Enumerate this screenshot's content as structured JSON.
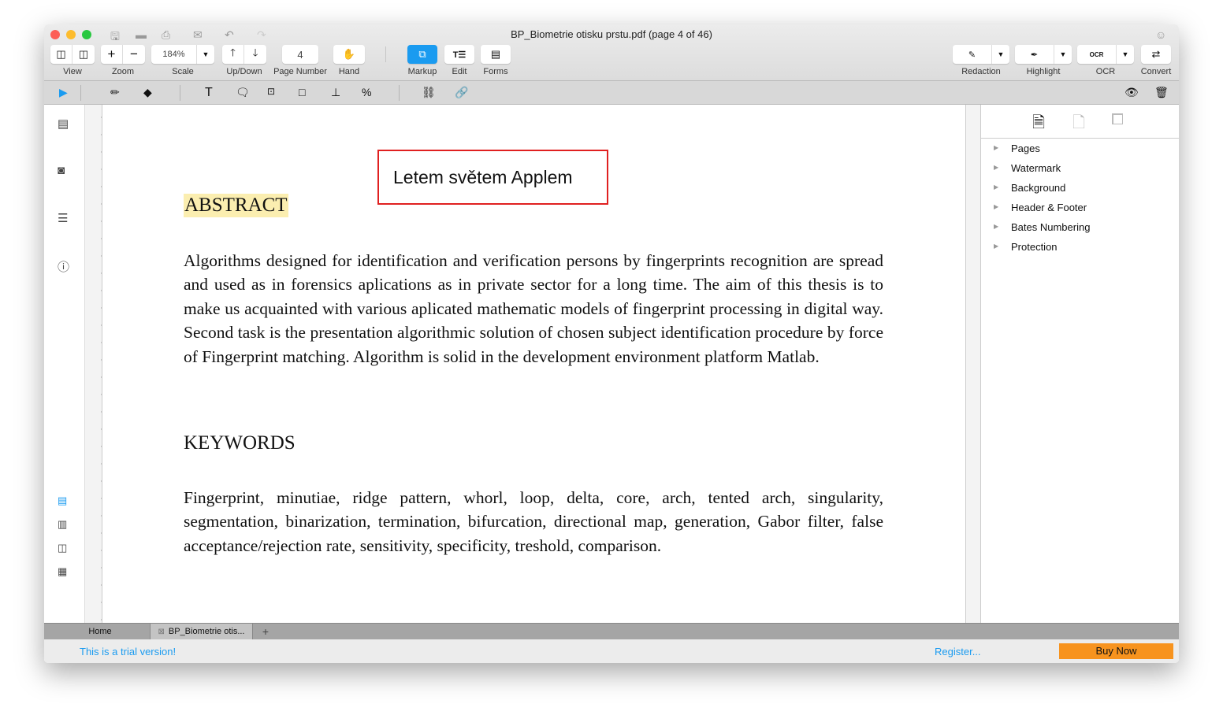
{
  "window": {
    "title": "BP_Biometrie otisku prstu.pdf (page 4 of 46)"
  },
  "toolbar": {
    "view": "View",
    "zoom": "Zoom",
    "scale": "Scale",
    "scale_value": "184%",
    "updown": "Up/Down",
    "page_number": "Page Number",
    "page_value": "4",
    "hand": "Hand",
    "markup": "Markup",
    "edit": "Edit",
    "forms": "Forms",
    "redaction": "Redaction",
    "highlight": "Highlight",
    "ocr": "OCR",
    "convert": "Convert"
  },
  "document": {
    "annotation": "Letem světem Applem",
    "abstract_heading": "ABSTRACT",
    "abstract_text": "Algorithms designed for identification and verification persons by fingerprints recognition are spread and used as in forensics aplications as in private sector for a long time. The aim of this thesis is to make us acquainted with various aplicated mathematic models of  fingerprint processing in digital way. Second task is the presentation algorithmic solution of chosen subject identification procedure by force of Fingerprint matching. Algorithm is solid in the development environment platform Matlab.",
    "keywords_heading": "KEYWORDS",
    "keywords_text": "Fingerprint, minutiae, ridge pattern, whorl, loop, delta, core, arch, tented arch, singularity, segmentation, binarization, termination, bifurcation, directional map, generation, Gabor filter, false acceptance/rejection rate, sensitivity, specificity, treshold, comparison."
  },
  "right_panel": {
    "items": [
      "Pages",
      "Watermark",
      "Background",
      "Header & Footer",
      "Bates Numbering",
      "Protection"
    ]
  },
  "tabs": {
    "home": "Home",
    "doc": "BP_Biometrie otis...",
    "add": "+"
  },
  "status": {
    "trial": "This is a trial version!",
    "register": "Register...",
    "buy": "Buy Now"
  },
  "colors": {
    "accent": "#1a9bf0",
    "buy": "#f7931e",
    "annotation_border": "#e02020",
    "highlight": "#fbeeb0"
  }
}
